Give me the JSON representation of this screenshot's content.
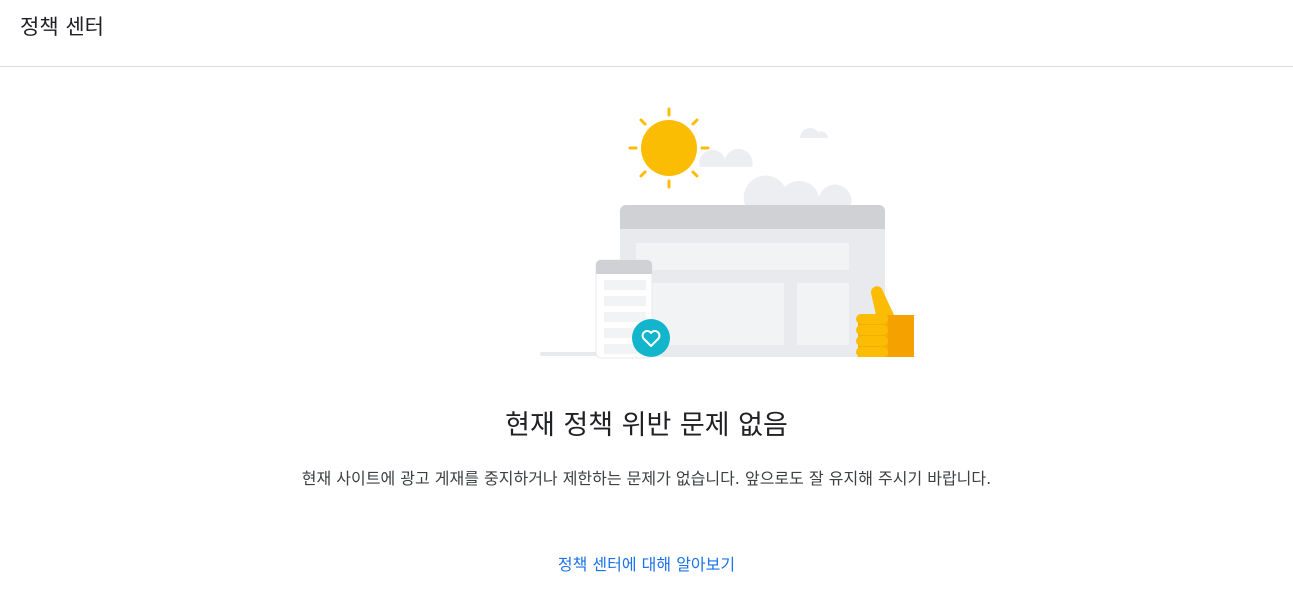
{
  "header": {
    "title": "정책 센터"
  },
  "status": {
    "heading": "현재 정책 위반 문제 없음",
    "description": "현재 사이트에 광고 게재를 중지하거나 제한하는 문제가 없습니다. 앞으로도 잘 유지해 주시기 바랍니다."
  },
  "links": {
    "learn_more": "정책 센터에 대해 알아보기"
  },
  "colors": {
    "sun": "#fbbc04",
    "thumb": "#f9ab00",
    "heart_badge": "#12b5cb",
    "link": "#1a73e8"
  },
  "icons": {
    "illustration": "no-issues-illustration",
    "sun": "sun-icon",
    "heart": "heart-icon",
    "thumbs_up": "thumbs-up-icon"
  }
}
